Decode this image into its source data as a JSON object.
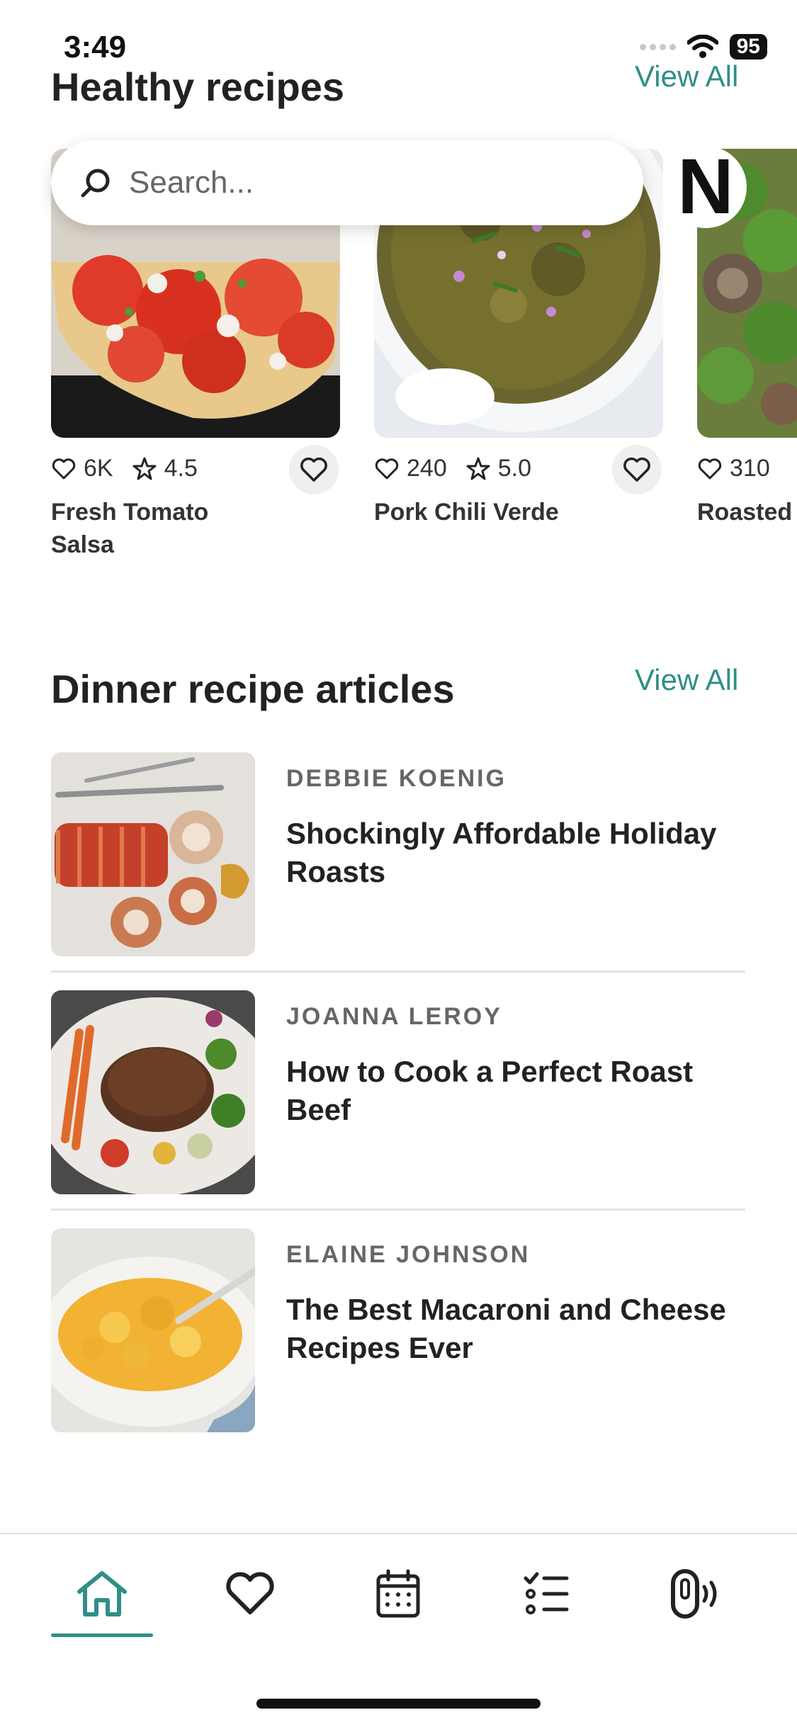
{
  "status": {
    "time": "3:49",
    "battery": "95"
  },
  "healthy": {
    "title": "Healthy recipes",
    "view_all": "View All",
    "search_placeholder": "Search...",
    "cards": [
      {
        "likes": "6K",
        "rating": "4.5",
        "title": "Fresh Tomato Salsa"
      },
      {
        "likes": "240",
        "rating": "5.0",
        "title": "Pork Chili Verde"
      },
      {
        "likes": "310",
        "title": "Roasted and Mus"
      }
    ]
  },
  "dinner": {
    "title": "Dinner recipe articles",
    "view_all": "View All",
    "articles": [
      {
        "author": "DEBBIE KOENIG",
        "title": "Shockingly Affordable Holiday Roasts"
      },
      {
        "author": "JOANNA LEROY",
        "title": "How to Cook a Perfect Roast Beef"
      },
      {
        "author": "ELAINE JOHNSON",
        "title": "The Best Macaroni and Cheese Recipes Ever"
      }
    ]
  },
  "brand_badge": "N",
  "colors": {
    "accent": "#2f8f86"
  },
  "tabbar": {
    "icons": [
      "home-icon",
      "heart-icon",
      "calendar-icon",
      "checklist-icon",
      "smart-device-icon"
    ],
    "active_index": 0
  }
}
